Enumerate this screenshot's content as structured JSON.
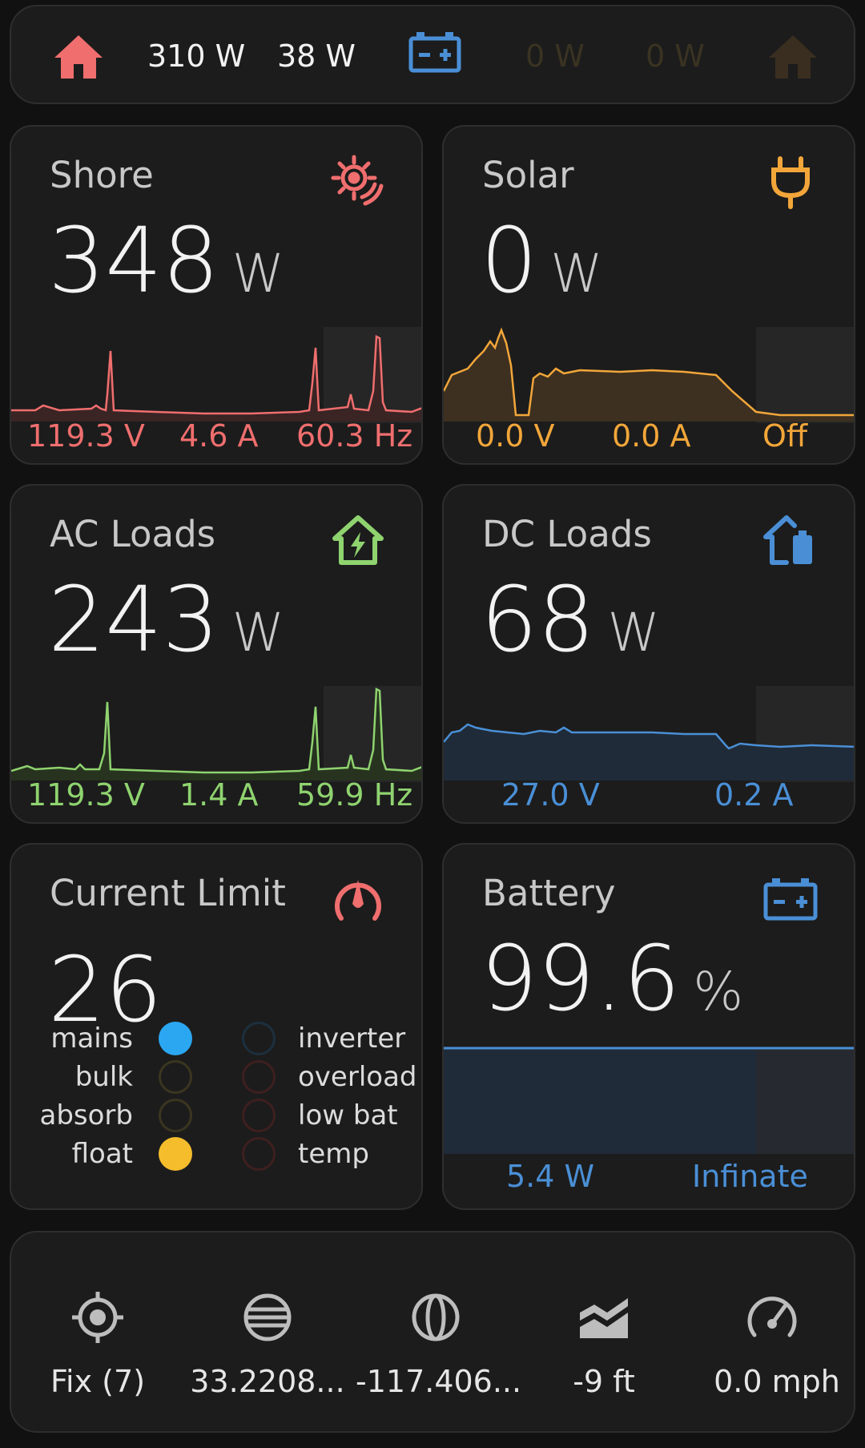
{
  "topbar": {
    "power_left_1": "310 W",
    "power_left_2": "38 W",
    "power_right_1": "0 W",
    "power_right_2": "0 W",
    "icons": [
      "home-icon",
      "battery-icon",
      "home-icon"
    ]
  },
  "shore": {
    "title": "Shore",
    "value": "348",
    "unit": "W",
    "voltage": "119.3 V",
    "current": "4.6 A",
    "freq": "60.3 Hz",
    "color": "#f06e6e",
    "icon": "transmission-tower-icon"
  },
  "solar": {
    "title": "Solar",
    "value": "0",
    "unit": "W",
    "voltage": "0.0 V",
    "current": "0.0 A",
    "state": "Off",
    "color": "#f2a63a",
    "icon": "plug-icon"
  },
  "ac_loads": {
    "title": "AC Loads",
    "value": "243",
    "unit": "W",
    "voltage": "119.3 V",
    "current": "1.4 A",
    "freq": "59.9 Hz",
    "color": "#8fd36f",
    "icon": "home-lightning-icon"
  },
  "dc_loads": {
    "title": "DC Loads",
    "value": "68",
    "unit": "W",
    "voltage": "27.0 V",
    "current": "0.2 A",
    "color": "#4a8fd6",
    "icon": "home-battery-icon"
  },
  "current_limit": {
    "title": "Current Limit",
    "value": "26",
    "icon": "gauge-icon",
    "leds_left": [
      {
        "label": "mains",
        "on": true,
        "color": "#2ba7f2"
      },
      {
        "label": "bulk",
        "on": false,
        "color": "#3b3520"
      },
      {
        "label": "absorb",
        "on": false,
        "color": "#3b3520"
      },
      {
        "label": "float",
        "on": true,
        "color": "#f5bd2c"
      }
    ],
    "leds_right": [
      {
        "label": "inverter",
        "on": false,
        "color": "#1c2f3e"
      },
      {
        "label": "overload",
        "on": false,
        "color": "#3e1f1f"
      },
      {
        "label": "low bat",
        "on": false,
        "color": "#3e1f1f"
      },
      {
        "label": "temp",
        "on": false,
        "color": "#3e1f1f"
      }
    ]
  },
  "battery": {
    "title": "Battery",
    "value": "99.6",
    "unit": "%",
    "power": "5.4 W",
    "state": "Infinate",
    "color": "#4a8fd6",
    "icon": "battery-icon"
  },
  "gps": {
    "fix": "Fix (7)",
    "latitude": "33.2208...",
    "longitude": "-117.406...",
    "altitude": "-9 ft",
    "speed": "0.0 mph",
    "icons": [
      "crosshairs-gps-icon",
      "latitude-icon",
      "longitude-icon",
      "altitude-icon",
      "speedometer-icon"
    ]
  }
}
